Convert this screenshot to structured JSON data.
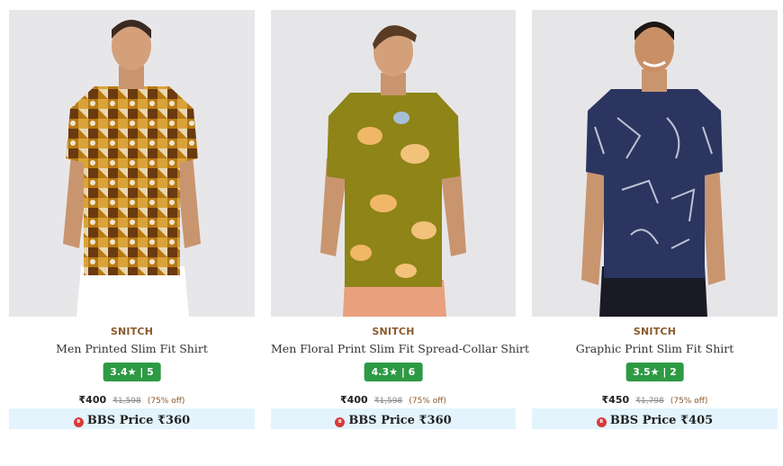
{
  "products": [
    {
      "brand": "SNITCH",
      "title": "Men Printed Slim Fit Shirt",
      "rating": "3.4★ | 5",
      "price": "₹400",
      "mrp": "₹1,598",
      "discount": "(75% off)",
      "bbs_price": "BBS Price ₹360",
      "bbs_icon": "bbs-badge-icon"
    },
    {
      "brand": "SNITCH",
      "title": "Men Floral Print Slim Fit Spread-Collar Shirt",
      "rating": "4.3★ | 6",
      "price": "₹400",
      "mrp": "₹1,598",
      "discount": "(75% off)",
      "bbs_price": "BBS Price ₹360",
      "bbs_icon": "bbs-badge-icon"
    },
    {
      "brand": "SNITCH",
      "title": "Graphic Print Slim Fit Shirt",
      "rating": "3.5★ | 2",
      "price": "₹450",
      "mrp": "₹1,798",
      "discount": "(75% off)",
      "bbs_price": "BBS Price ₹405",
      "bbs_icon": "bbs-badge-icon"
    }
  ],
  "colors": {
    "brand_text": "#8a5a2c",
    "rating_badge": "#2e9a44",
    "bbs_bg": "#e3f4fd",
    "image_bg": "#e6e6e8"
  }
}
